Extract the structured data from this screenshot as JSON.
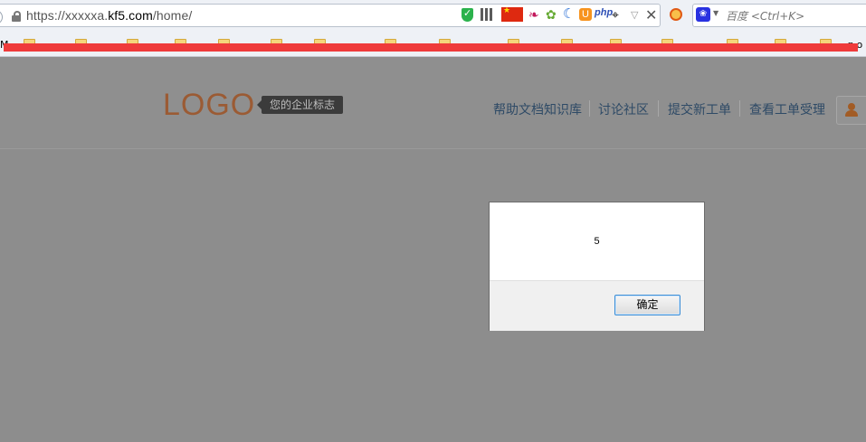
{
  "browser": {
    "url_prefix": "https://xxxxxa.",
    "url_domain": "kf5.com",
    "url_path": "/home/",
    "search_placeholder": "百度 <Ctrl+K>",
    "bookmarks_first_char": "M",
    "bookmarks_last_chars": "g o"
  },
  "header": {
    "logo_text": "LOGO",
    "logo_tagline": "您的企业标志"
  },
  "nav": {
    "items": [
      "帮助文档知识库",
      "讨论社区",
      "提交新工单",
      "查看工单受理"
    ]
  },
  "dialog": {
    "message": "5",
    "ok_label": "确定"
  },
  "colors": {
    "redaction": "#ef3b3b",
    "logo": "#9b5b34",
    "overlay_bg": "#8d8d8d",
    "button_border": "#3c8ed6"
  },
  "icons": [
    "shield-icon",
    "qr-code-icon",
    "china-flag-icon",
    "feather-icon",
    "pinwheel-icon",
    "moon-icon",
    "uc-icon",
    "php-icon",
    "pin-icon",
    "dropdown-icon",
    "close-icon",
    "noscript-icon",
    "baidu-icon",
    "user-icon"
  ]
}
